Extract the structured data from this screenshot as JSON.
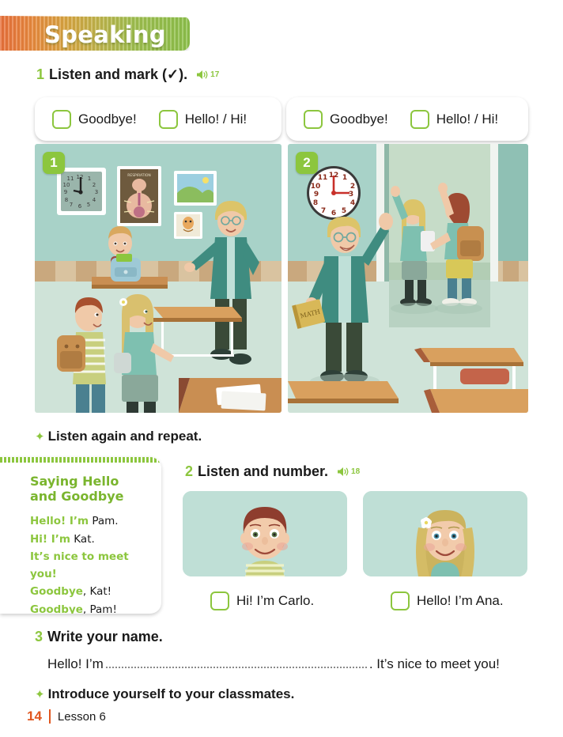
{
  "header": {
    "title": "Speaking"
  },
  "exercise1": {
    "number": "1",
    "text": "Listen and mark (✓).",
    "audio_track": "17",
    "audio_icon": "speaker-icon",
    "options": [
      {
        "label": "Goodbye!",
        "checked": false
      },
      {
        "label": "Hello! / Hi!",
        "checked": false
      }
    ],
    "panels": [
      {
        "badge": "1",
        "scene": "classroom-arrival",
        "description": "Teacher greeting students arriving in classroom"
      },
      {
        "badge": "2",
        "scene": "classroom-departure",
        "description": "Teacher waving goodbye as students leave"
      }
    ],
    "repeat_instruction": "Listen again and repeat.",
    "bullet_icon": "star-bullet-icon"
  },
  "sidebar": {
    "title": "Saying Hello and Goodbye",
    "lines": [
      {
        "green": "Hello! I’m",
        "black": " Pam."
      },
      {
        "green": "Hi! I’m",
        "black": " Kat."
      },
      {
        "green": "It’s nice to meet you!",
        "black": ""
      },
      {
        "green": "Goodbye",
        "black": ", Kat!"
      },
      {
        "green": "Goodbye",
        "black": ", Pam!"
      }
    ]
  },
  "exercise2": {
    "number": "2",
    "text": "Listen and number.",
    "audio_track": "18",
    "audio_icon": "speaker-icon",
    "cards": [
      {
        "name": "Carlo",
        "label": "Hi! I’m Carlo.",
        "checked": false,
        "hair": "red-brown",
        "shirt": "striped-green"
      },
      {
        "name": "Ana",
        "label": "Hello! I’m Ana.",
        "checked": false,
        "hair": "blonde",
        "shirt": "teal"
      }
    ]
  },
  "exercise3": {
    "number": "3",
    "text": "Write your name.",
    "prefix": "Hello! I’m",
    "blank_value": "",
    "suffix": ". It’s nice to meet you!",
    "closing_instruction": "Introduce yourself to your classmates.",
    "bullet_icon": "star-bullet-icon"
  },
  "footer": {
    "page_number": "14",
    "lesson": "Lesson 6"
  },
  "colors": {
    "green": "#8cc63e",
    "dark_green": "#7ab52e",
    "orange": "#e0561f",
    "banner_orange": "#e8703a",
    "panel_bg": "#bfdfd6"
  }
}
